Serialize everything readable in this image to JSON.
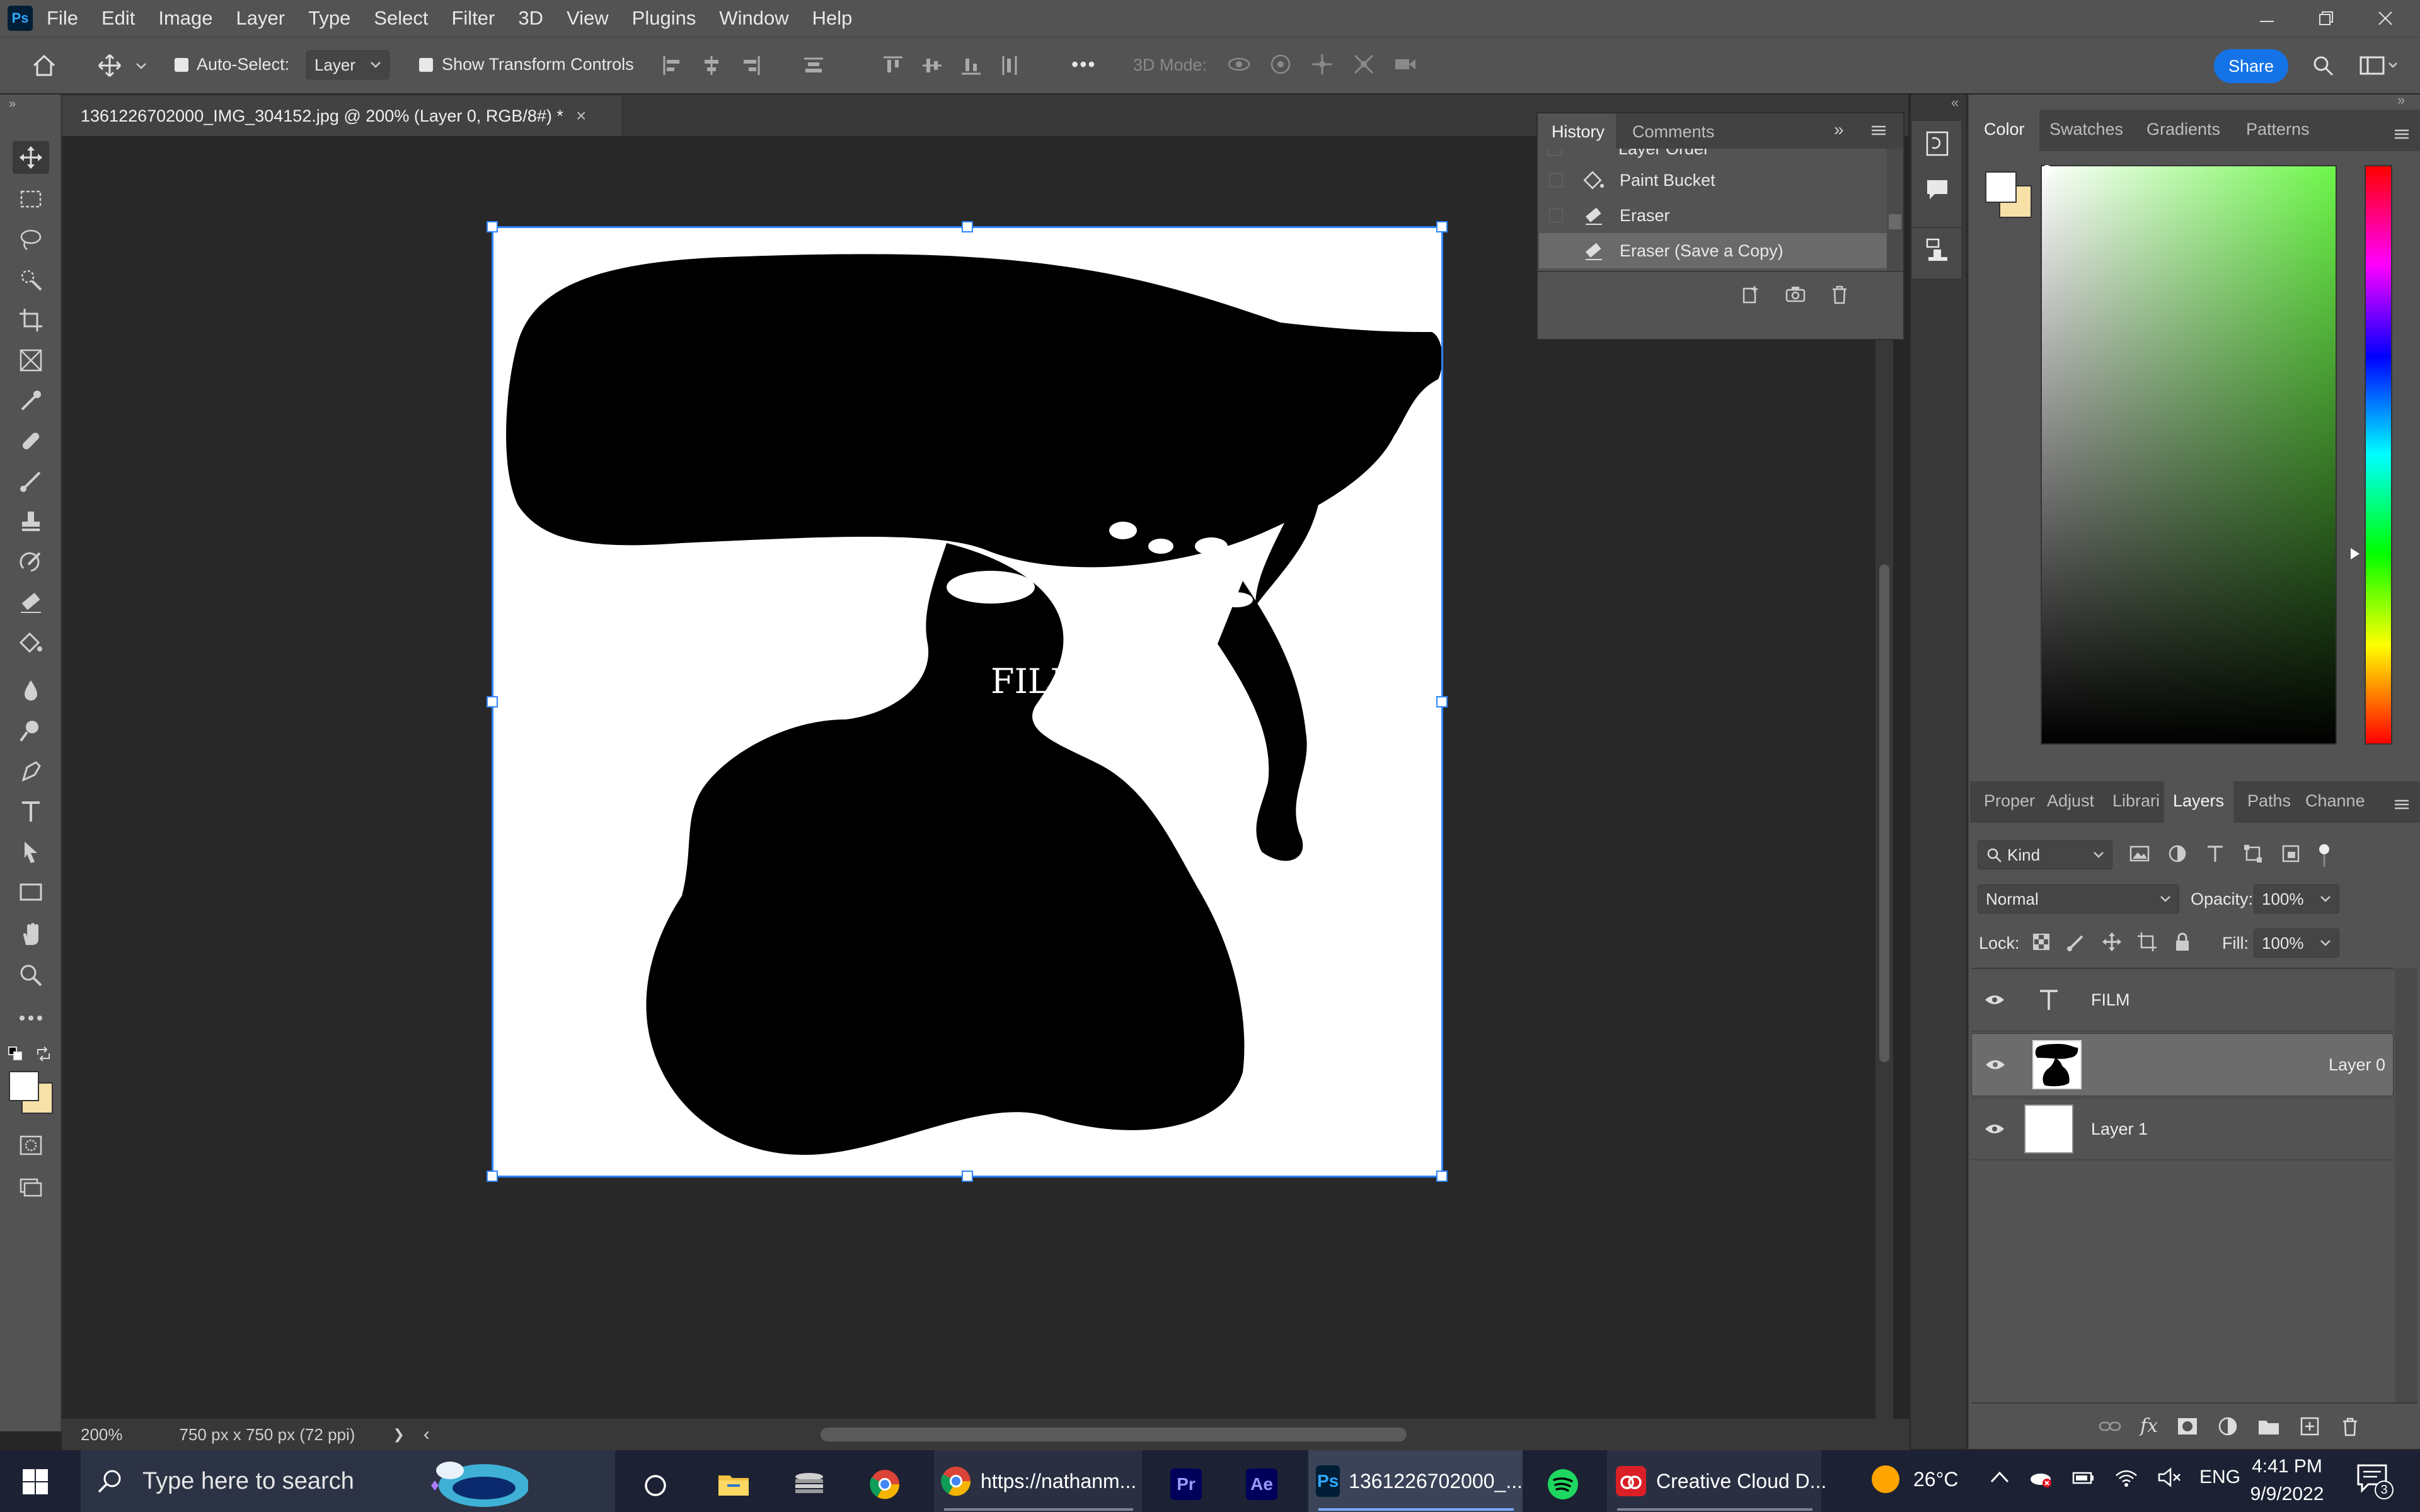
{
  "app": {
    "logo": "Ps",
    "accent": "#1473e6",
    "selection_color": "#2e84ff"
  },
  "menu": [
    "File",
    "Edit",
    "Image",
    "Layer",
    "Type",
    "Select",
    "Filter",
    "3D",
    "View",
    "Plugins",
    "Window",
    "Help"
  ],
  "options_bar": {
    "auto_select_label": "Auto-Select:",
    "auto_select_value": "Layer",
    "transform_label": "Show Transform Controls",
    "more": "•••",
    "mode_3d": "3D Mode:",
    "share": "Share"
  },
  "document": {
    "tab_title": "1361226702000_IMG_304152.jpg @ 200% (Layer 0, RGB/8#) *",
    "close": "×",
    "canvas_text": "FILM"
  },
  "status": {
    "zoom": "200%",
    "info": "750 px x 750 px (72 ppi)",
    "arrow_right": "❯",
    "arrow_left": "‹"
  },
  "history": {
    "tabs": [
      "History",
      "Comments"
    ],
    "partial_item": "Layer Order",
    "items": [
      "Paint Bucket",
      "Eraser",
      "Eraser (Save a Copy)"
    ]
  },
  "color_panel": {
    "tabs": [
      "Color",
      "Swatches",
      "Gradients",
      "Patterns"
    ],
    "foreground": "#ffffff",
    "background": "#f7e1a8"
  },
  "layers_panel": {
    "tabs": [
      "Proper",
      "Adjust",
      "Librari",
      "Layers",
      "Paths",
      "Channe"
    ],
    "filter_kind": "Kind",
    "blend_mode": "Normal",
    "opacity_label": "Opacity:",
    "opacity_value": "100%",
    "lock_label": "Lock:",
    "fill_label": "Fill:",
    "fill_value": "100%",
    "layers": [
      {
        "name": "FILM",
        "type": "text"
      },
      {
        "name": "Layer 0",
        "type": "image",
        "selected": true
      },
      {
        "name": "Layer 1",
        "type": "fill"
      }
    ]
  },
  "taskbar": {
    "search_placeholder": "Type here to search",
    "chrome_title": "https://nathanm...",
    "ps_title": "1361226702000_...",
    "cc_title": "Creative Cloud D...",
    "weather": "26°C",
    "lang": "ENG",
    "time": "4:41 PM",
    "date": "9/9/2022",
    "notifications": "3"
  }
}
